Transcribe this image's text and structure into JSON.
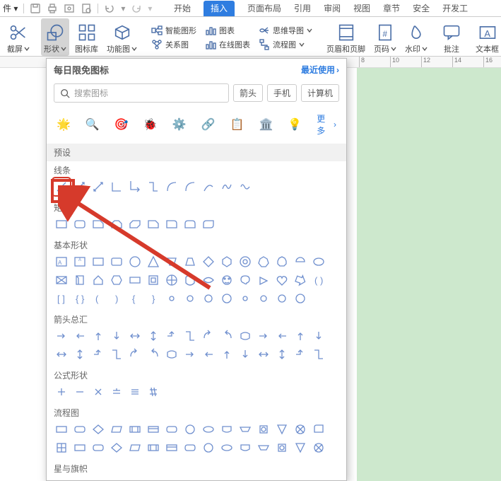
{
  "quickbar_truncated": "件 ▾",
  "tabs": {
    "start": "开始",
    "insert": "插入",
    "layout": "页面布局",
    "ref": "引用",
    "review": "审阅",
    "view": "视图",
    "chapter": "章节",
    "safe": "安全",
    "dev": "开发工"
  },
  "ribbon": {
    "screenshot": "截屏",
    "shapes": "形状",
    "iconlib": "图标库",
    "funcimg": "功能图",
    "smartart": "智能图形",
    "chart": "图表",
    "relation": "关系图",
    "mindmap": "思维导图",
    "onlinechart": "在线图表",
    "flowchart": "流程图",
    "headerfooter": "页眉和页脚",
    "pagenum": "页码",
    "watermark": "水印",
    "comment": "批注",
    "textbox": "文本框"
  },
  "ruler_ticks": [
    "8",
    "10",
    "12",
    "14",
    "16"
  ],
  "panel": {
    "title": "每日限免图标",
    "recent": "最近使用",
    "search_placeholder": "搜索图标",
    "tags": {
      "arrow": "箭头",
      "phone": "手机",
      "computer": "计算机"
    },
    "more": "更多",
    "preset": "预设",
    "categories": {
      "lines": "线条",
      "rect": "矩形",
      "basic": "基本形状",
      "arrows": "箭头总汇",
      "formula": "公式形状",
      "flow": "流程图",
      "stars": "星与旗帜"
    }
  }
}
